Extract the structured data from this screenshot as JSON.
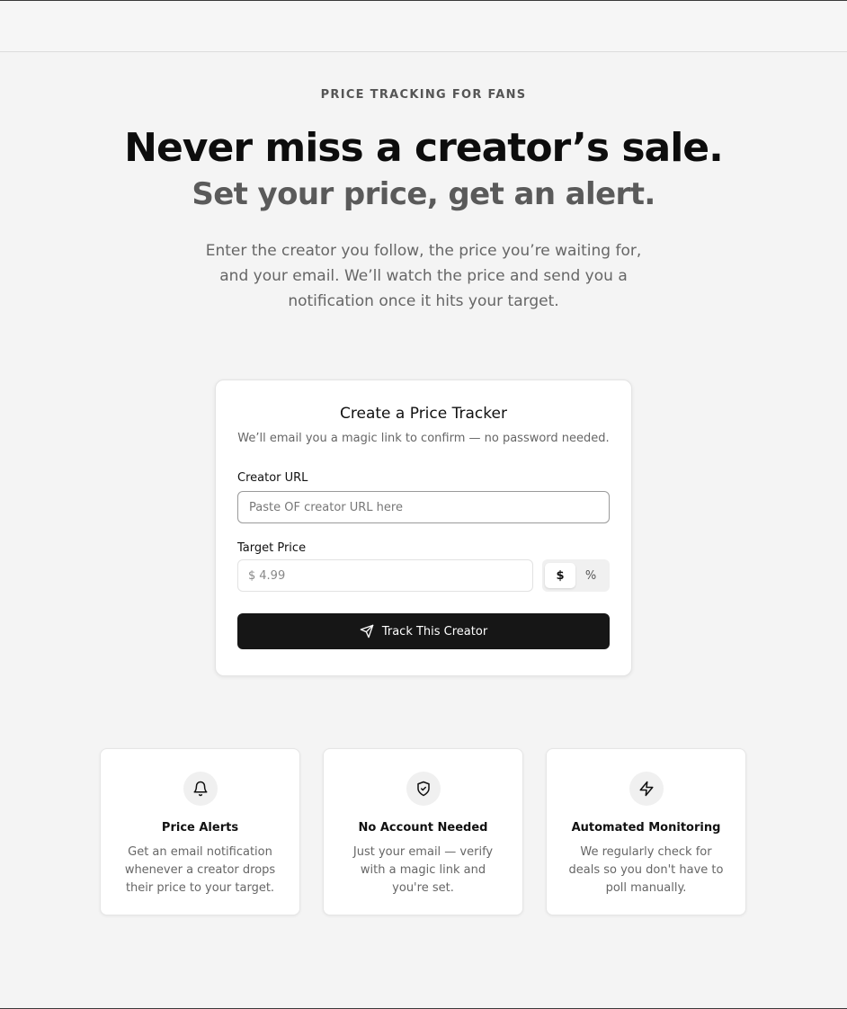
{
  "hero": {
    "eyebrow": "PRICE TRACKING FOR FANS",
    "headline": "Never miss a creator’s sale.",
    "subheadline": "Set your price, get an alert.",
    "intro": "Enter the creator you follow, the price you’re waiting for, and your email. We’ll watch the price and send you a notification once it hits your target."
  },
  "form": {
    "title": "Create a Price Tracker",
    "subtitle": "We’ll email you a magic link to confirm — no password needed.",
    "url_label": "Creator URL",
    "url_placeholder": "Paste OF creator URL here",
    "price_label": "Target Price",
    "currency_symbol": "$",
    "price_placeholder": "4.99",
    "toggle_options": [
      "$",
      "%"
    ],
    "toggle_selected": "$",
    "submit_label": "Track This Creator",
    "submit_icon": "send-icon"
  },
  "features": [
    {
      "icon": "bell-icon",
      "title": "Price Alerts",
      "text": "Get an email notification whenever a creator drops their price to your target."
    },
    {
      "icon": "shield-check-icon",
      "title": "No Account Needed",
      "text": "Just your email — verify with a magic link and you're set."
    },
    {
      "icon": "lightning-icon",
      "title": "Automated Monitoring",
      "text": "We regularly check for deals so you don't have to poll manually."
    }
  ],
  "colors": {
    "background": "#f4f4f4",
    "button": "#161616",
    "heading": "#0d0d0d",
    "subheading": "#5a5a5a"
  }
}
